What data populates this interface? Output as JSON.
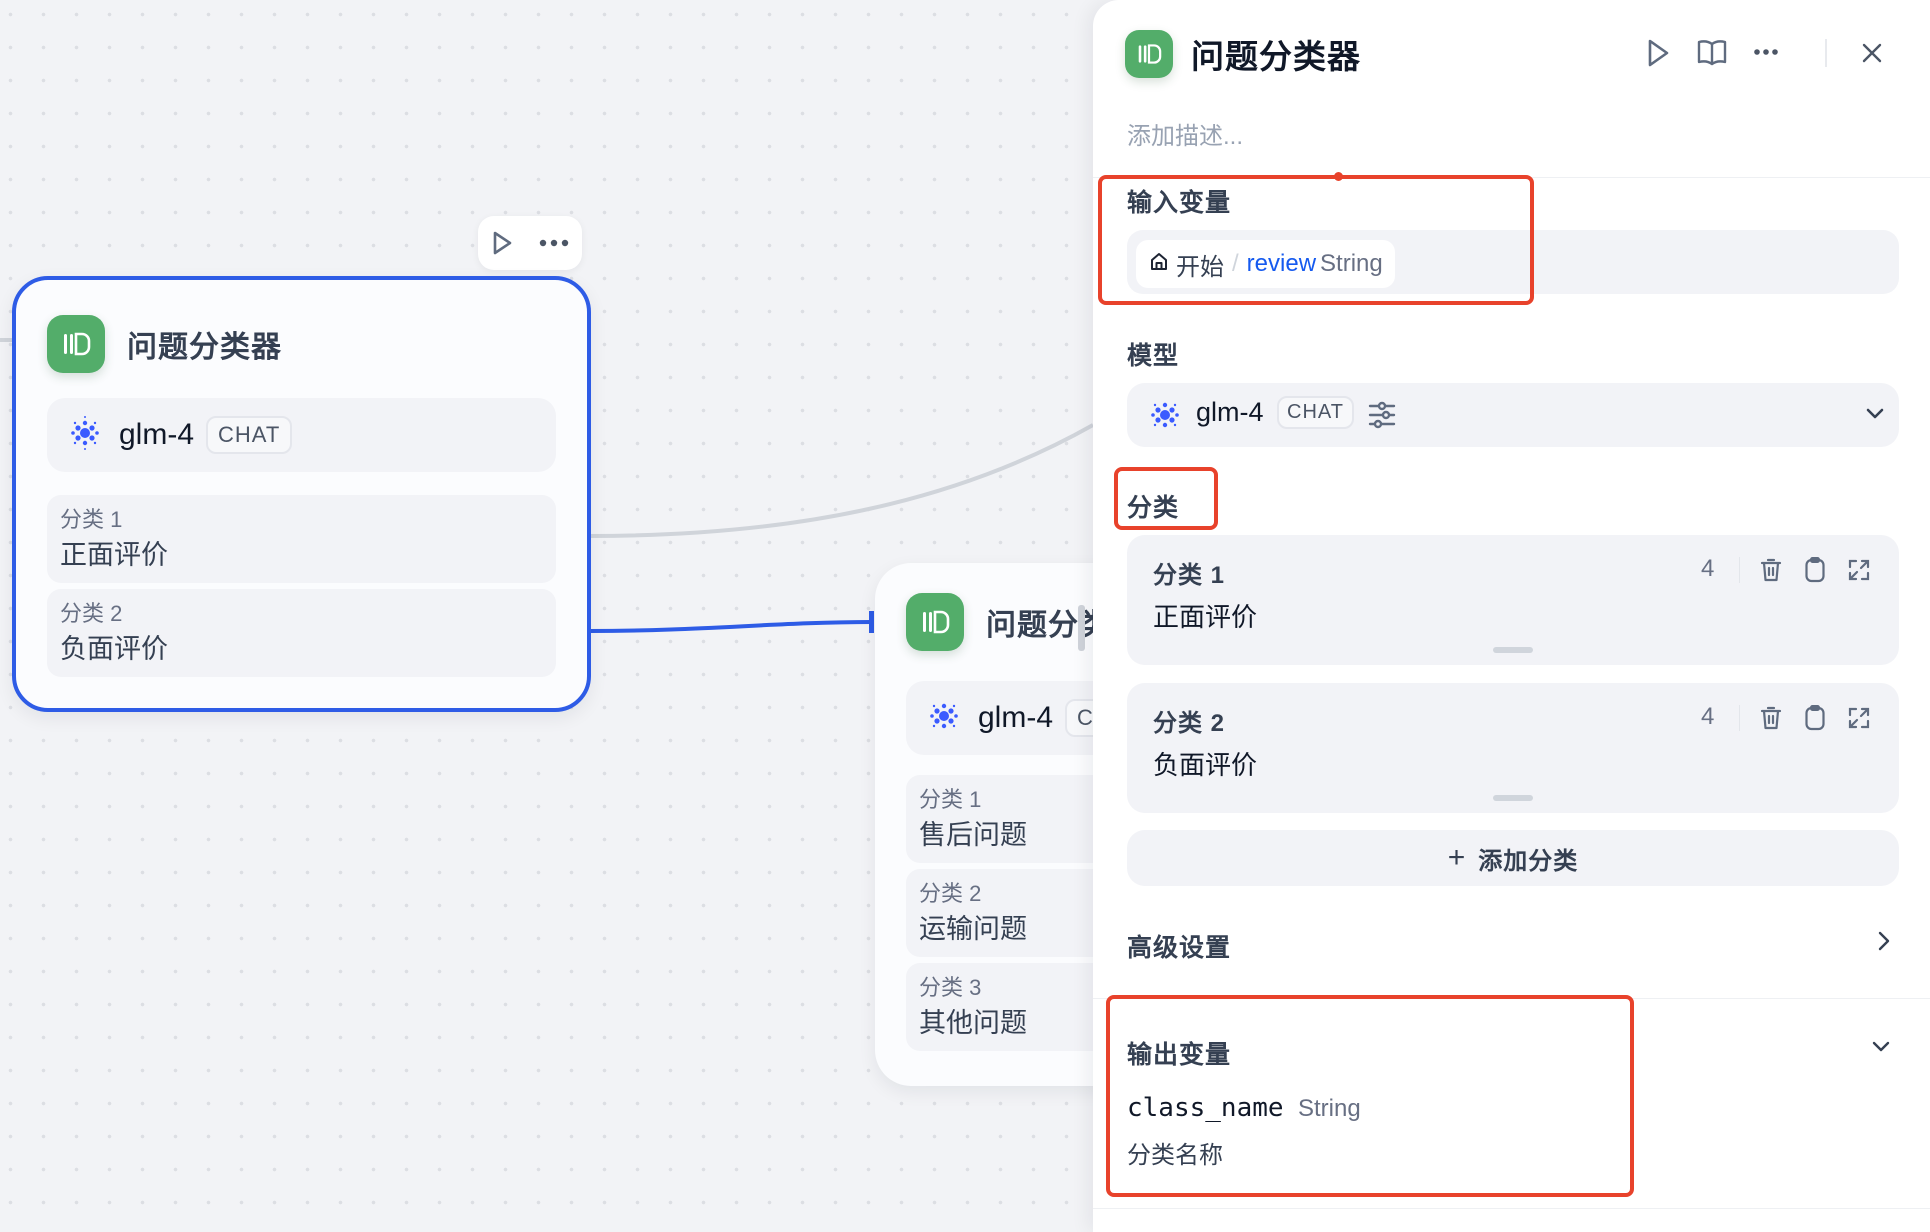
{
  "canvas": {
    "nodes": [
      {
        "title": "问题分类器",
        "selected": true,
        "model": {
          "name": "glm-4",
          "mode": "CHAT"
        },
        "classes": [
          {
            "label": "分类 1",
            "text": "正面评价"
          },
          {
            "label": "分类 2",
            "text": "负面评价"
          }
        ],
        "toolbar": {
          "run_icon": "play-icon",
          "more_icon": "more-dots-icon"
        }
      },
      {
        "title": "问题分类器",
        "title_visible": "问题分",
        "selected": false,
        "model": {
          "name": "glm-4",
          "mode": "CHAT"
        },
        "classes": [
          {
            "label": "分类 1",
            "text": "售后问题"
          },
          {
            "label": "分类 2",
            "text": "运输问题"
          },
          {
            "label": "分类 3",
            "text": "其他问题"
          }
        ]
      }
    ],
    "colors": {
      "selected_edge": "#2e5ce6",
      "edge": "#d0d4da",
      "node_icon": "#53ad6a"
    }
  },
  "panel": {
    "title": "问题分类器",
    "description_placeholder": "添加描述...",
    "header_icons": [
      "play-icon",
      "book-icon",
      "more-dots-icon",
      "close-icon"
    ],
    "input": {
      "label": "输入变量",
      "variable": {
        "node": "开始",
        "separator": "/",
        "name": "review",
        "type": "String"
      }
    },
    "model": {
      "label": "模型",
      "name": "glm-4",
      "mode": "CHAT"
    },
    "classes": {
      "label": "分类",
      "items": [
        {
          "title": "分类 1",
          "text": "正面评价",
          "count": "4"
        },
        {
          "title": "分类 2",
          "text": "负面评价",
          "count": "4"
        }
      ],
      "add_label": "添加分类",
      "add_plus": "+"
    },
    "advanced": {
      "label": "高级设置"
    },
    "output": {
      "label": "输出变量",
      "variables": [
        {
          "name": "class_name",
          "type": "String",
          "description": "分类名称"
        }
      ]
    }
  },
  "annotations": {
    "highlight_color": "#e8422b"
  }
}
